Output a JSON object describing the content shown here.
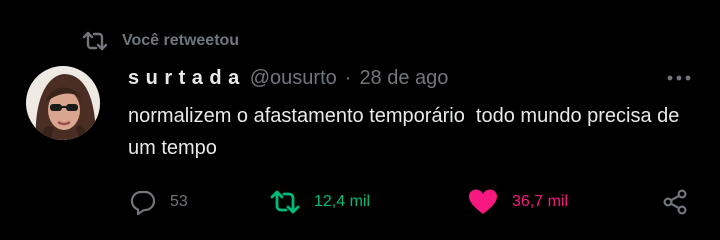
{
  "retweet_banner": {
    "label": "Você retweetou"
  },
  "tweet": {
    "display_name": "surtada",
    "handle": "@ousurto",
    "separator": "·",
    "date": "28 de ago",
    "text": "normalizem o afastamento temporário  todo mundo precisa de um tempo"
  },
  "actions": {
    "replies": "53",
    "retweets": "12,4 mil",
    "likes": "36,7 mil"
  },
  "colors": {
    "background": "#000000",
    "text": "#e7e9ea",
    "muted": "#71767b",
    "retweet_active": "#00ba7c",
    "like_active": "#f91880"
  },
  "icons": {
    "retweet_banner": "retweet-icon",
    "more": "more-options-icon",
    "reply": "reply-icon",
    "retweet": "retweet-icon",
    "like": "heart-filled-icon",
    "share": "share-icon"
  }
}
